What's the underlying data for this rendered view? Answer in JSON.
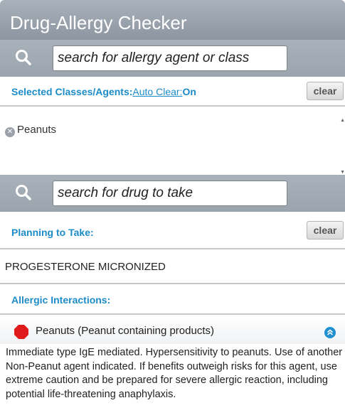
{
  "app": {
    "title": "Drug-Allergy Checker"
  },
  "allergy_search": {
    "placeholder": "search for allergy agent or class"
  },
  "selected": {
    "label": "Selected Classes/Agents:",
    "auto_clear_label": "Auto Clear:",
    "auto_clear_value": "On",
    "clear_label": "clear",
    "items": [
      {
        "label": "Peanuts"
      }
    ]
  },
  "drug_search": {
    "placeholder": "search for drug to take"
  },
  "planning": {
    "label": "Planning to Take:",
    "clear_label": "clear",
    "drugs": [
      {
        "name": "PROGESTERONE MICRONIZED"
      }
    ]
  },
  "interactions": {
    "label": "Allergic Interactions:",
    "items": [
      {
        "title": "Peanuts (Peanut containing products)",
        "severity_color": "#e01b1b",
        "detail": "Immediate type IgE mediated. Hypersensitivity to peanuts. Use of another Non-Peanut agent indicated. If benefits outweigh risks for this agent, use extreme caution and be prepared for severe allergic reaction, including potential life-threatening anaphylaxis."
      }
    ]
  },
  "colors": {
    "accent": "#1c8cc8",
    "header_gray": "#9ba4ad",
    "severity_red": "#e01b1b"
  },
  "icons": {
    "search": "search-icon",
    "remove": "remove-chip-icon",
    "stop": "stop-sign-icon",
    "expand": "collapse-chevron-icon"
  }
}
